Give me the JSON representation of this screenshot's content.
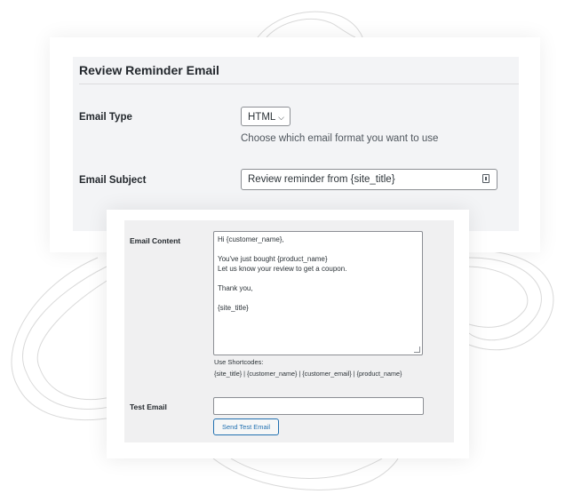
{
  "review_settings": {
    "section_title": "Review Reminder Email",
    "email_type": {
      "label": "Email Type",
      "selected_value": "HTML",
      "help_text": "Choose which email format you want to use"
    },
    "email_subject": {
      "label": "Email Subject",
      "value": "Review reminder from {site_title}",
      "icon": "shortcode-tag-icon"
    }
  },
  "email_content_panel": {
    "email_content_label": "Email Content",
    "content_lines": [
      "Hi {customer_name},",
      "",
      "You've just bought {product_name}",
      "Let us know your review to get a coupon.",
      "",
      "Thank you,",
      "",
      "{site_title}"
    ],
    "shortcodes_label": "Use Shortcodes:",
    "shortcodes_list": "{site_title} | {customer_name} | {customer_email} | {product_name}",
    "test_email_label": "Test Email",
    "test_email_value": "",
    "send_button_label": "Send Test Email",
    "accent_color": "#2271b1"
  }
}
